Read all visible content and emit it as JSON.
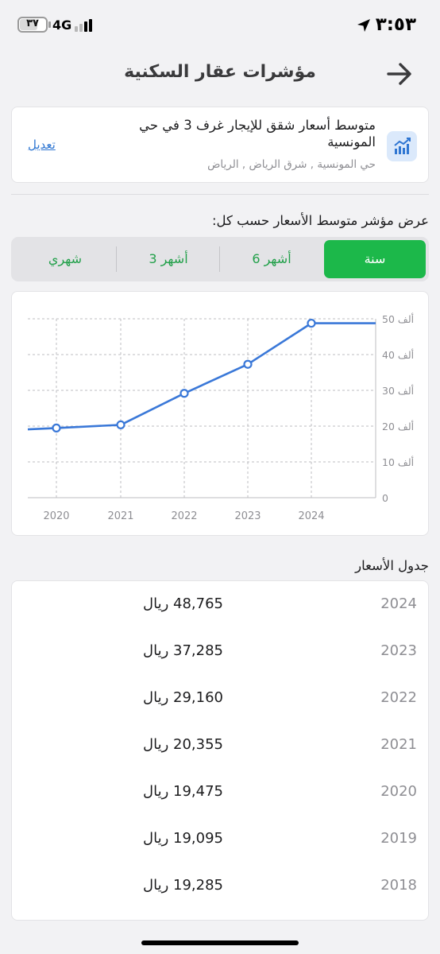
{
  "status_bar": {
    "time": "٣:٥٣",
    "network": "4G",
    "battery": "٣٧"
  },
  "nav": {
    "title": "مؤشرات عقار السكنية"
  },
  "summary": {
    "title": "متوسط أسعار شقق للإيجار غرف 3 في حي المونسية",
    "subtitle": "حي المونسية , شرق الرياض , الرياض",
    "edit_label": "تعديل",
    "icon": "chart-icon"
  },
  "period_label": "عرض مؤشر متوسط الأسعار حسب كل:",
  "periods": [
    "سنة",
    "6 أشهر",
    "3 أشهر",
    "شهري"
  ],
  "active_period": 0,
  "colors": {
    "accent": "#1cb84a",
    "line": "#3a78d8",
    "link": "#2f76d2"
  },
  "chart_data": {
    "type": "line",
    "x": [
      "2020",
      "2021",
      "2022",
      "2023",
      "2024"
    ],
    "series": [
      {
        "values": [
          19475,
          20355,
          29160,
          37285,
          48765
        ]
      }
    ],
    "ylim": [
      0,
      50000
    ],
    "yticks": [
      "0",
      "10 ألف",
      "20 ألف",
      "30 ألف",
      "40 ألف",
      "50 ألف"
    ],
    "grid": true,
    "xlabel": "",
    "ylabel": ""
  },
  "table_title": "جدول الأسعار",
  "table": [
    {
      "year": "2024",
      "price": "48,765 ريال"
    },
    {
      "year": "2023",
      "price": "37,285 ريال"
    },
    {
      "year": "2022",
      "price": "29,160 ريال"
    },
    {
      "year": "2021",
      "price": "20,355 ريال"
    },
    {
      "year": "2020",
      "price": "19,475 ريال"
    },
    {
      "year": "2019",
      "price": "19,095 ريال"
    },
    {
      "year": "2018",
      "price": "19,285 ريال"
    }
  ]
}
